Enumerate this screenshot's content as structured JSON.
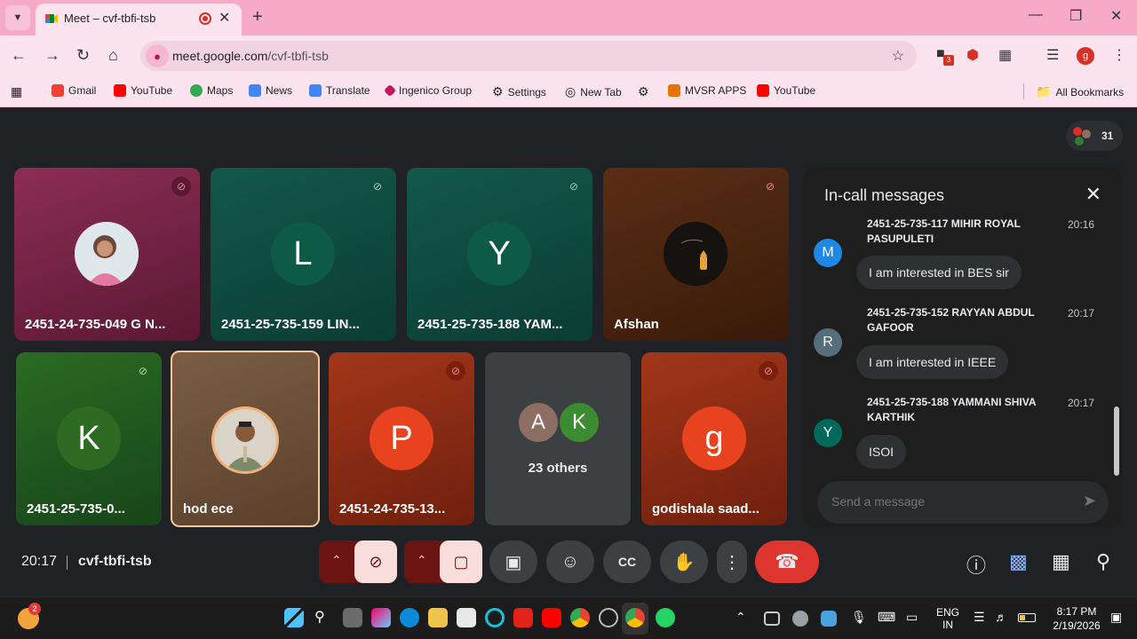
{
  "browser": {
    "tab_title": "Meet – cvf-tbfi-tsb",
    "url_host": "meet.google.com",
    "url_path": "/cvf-tbfi-tsb",
    "profile_initial": "g",
    "extension_badge": "3",
    "bookmarks": [
      {
        "label": "Gmail",
        "icon": "gmail-icon",
        "color": "#ea4335"
      },
      {
        "label": "YouTube",
        "icon": "youtube-icon",
        "color": "#ff0000"
      },
      {
        "label": "Maps",
        "icon": "maps-icon",
        "color": "#34a853"
      },
      {
        "label": "News",
        "icon": "news-icon",
        "color": "#4285f4"
      },
      {
        "label": "Translate",
        "icon": "translate-icon",
        "color": "#4285f4"
      },
      {
        "label": "Ingenico Group",
        "icon": "ingenico-icon",
        "color": "#c2185b"
      },
      {
        "label": "Settings",
        "icon": "gear-icon",
        "color": "#444444"
      },
      {
        "label": "New Tab",
        "icon": "chrome-icon",
        "color": "#444444"
      },
      {
        "label": "",
        "icon": "gear-icon",
        "color": "#444444"
      },
      {
        "label": "MVSR APPS",
        "icon": "mvsr-icon",
        "color": "#e37400"
      },
      {
        "label": "YouTube",
        "icon": "youtube-icon",
        "color": "#ff0000"
      }
    ],
    "all_bookmarks": "All Bookmarks"
  },
  "meet": {
    "participant_count": "31",
    "time": "20:17",
    "meeting_code": "cvf-tbfi-tsb",
    "tiles": [
      {
        "name": "2451-24-735-049 G N...",
        "initial": "",
        "kind": "photo-girl",
        "bg": "#6b1f3f",
        "muted": true
      },
      {
        "name": "2451-25-735-159 LIN...",
        "initial": "L",
        "kind": "letter",
        "bg": "#0f4d40",
        "circle": "#0e5a47",
        "muted": true
      },
      {
        "name": "2451-25-735-188 YAM...",
        "initial": "Y",
        "kind": "letter",
        "bg": "#0f4d40",
        "circle": "#0e5a47",
        "muted": true
      },
      {
        "name": "Afshan",
        "initial": "",
        "kind": "photo-night",
        "bg": "#4b2412",
        "muted": true
      },
      {
        "name": "2451-25-735-0...",
        "initial": "K",
        "kind": "letter",
        "bg": "#1f5a1c",
        "circle": "#2e6b22",
        "muted": true
      },
      {
        "name": "hod ece",
        "initial": "",
        "kind": "photo-man",
        "bg": "#6b5039",
        "muted": false
      },
      {
        "name": "2451-24-735-13...",
        "initial": "P",
        "kind": "letter",
        "bg": "#8b2a14",
        "circle": "#e8431f",
        "muted": true
      },
      {
        "name": "23 others",
        "initial": "",
        "kind": "others",
        "bg": "#3c4043",
        "muted": false
      },
      {
        "name": "godishala saad...",
        "initial": "g",
        "kind": "letter",
        "bg": "#8b2a14",
        "circle": "#e8431f",
        "muted": true
      }
    ],
    "others_avatars": [
      {
        "initial": "A",
        "color": "#8d6e63"
      },
      {
        "initial": "K",
        "color": "#3c8d2f"
      }
    ]
  },
  "chat": {
    "title": "In-call messages",
    "messages": [
      {
        "avatar": "M",
        "color": "#1e88e5",
        "sender": "2451-25-735-117 MIHIR ROYAL PASUPULETI",
        "time": "20:16",
        "text": "I am interested in BES sir"
      },
      {
        "avatar": "R",
        "color": "#546e7a",
        "sender": "2451-25-735-152 RAYYAN ABDUL GAFOOR",
        "time": "20:17",
        "text": "I am interested in IEEE"
      },
      {
        "avatar": "Y",
        "color": "#00695c",
        "sender": "2451-25-735-188 YAMMANI SHIVA KARTHIK",
        "time": "20:17",
        "text": "ISOI"
      }
    ],
    "input_placeholder": "Send a message"
  },
  "taskbar": {
    "widget_badge": "2",
    "lang_line1": "ENG",
    "lang_line2": "IN",
    "clock_time": "8:17 PM",
    "clock_date": "2/19/2026"
  }
}
